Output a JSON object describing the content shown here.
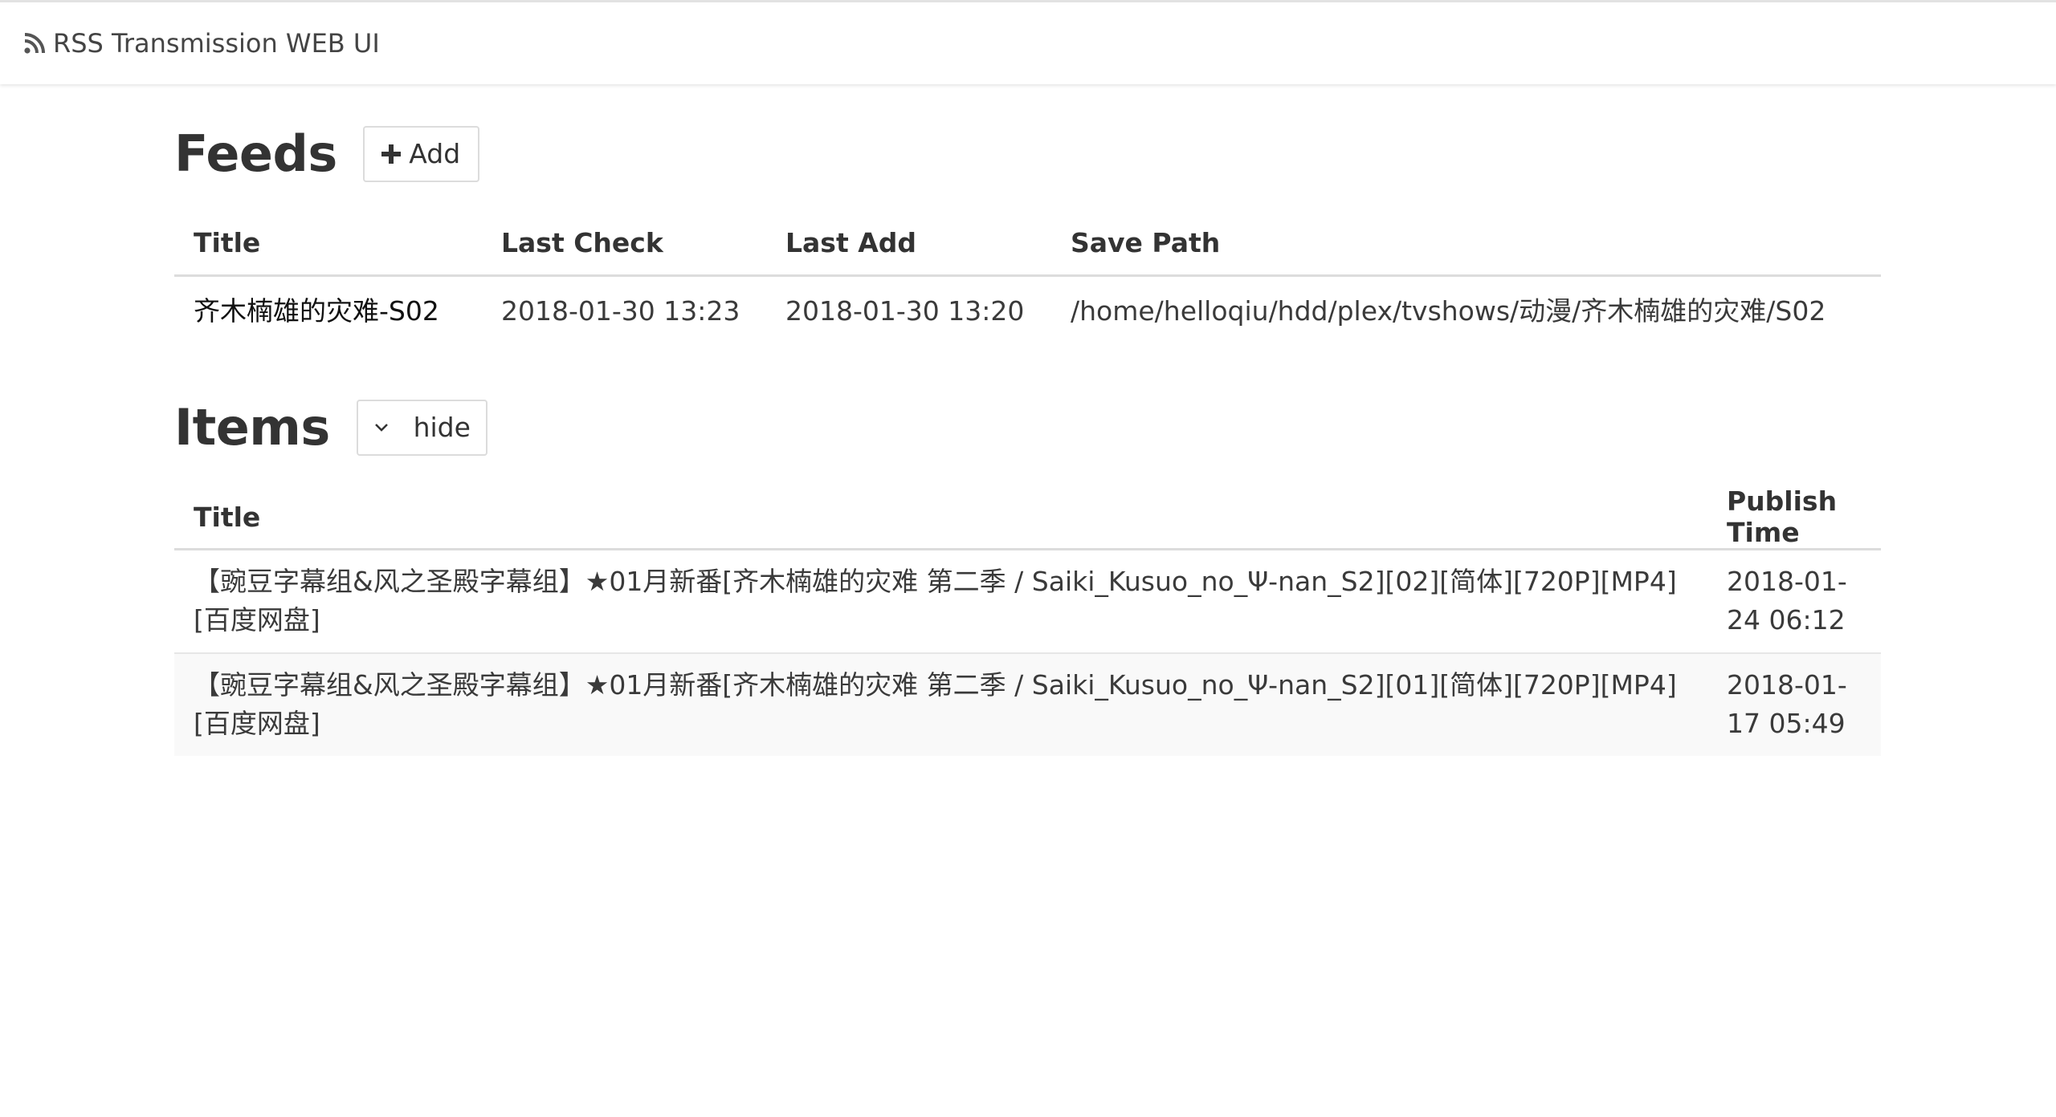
{
  "header": {
    "brand_icon": "rss-icon",
    "brand_text": "RSS Transmission WEB UI"
  },
  "feeds": {
    "heading": "Feeds",
    "add_button_icon": "plus-icon",
    "add_button_label": "Add",
    "columns": [
      "Title",
      "Last Check",
      "Last Add",
      "Save Path"
    ],
    "rows": [
      {
        "title": "齐木楠雄的灾难-S02",
        "last_check": "2018-01-30 13:23",
        "last_add": "2018-01-30 13:20",
        "save_path": "/home/helloqiu/hdd/plex/tvshows/动漫/齐木楠雄的灾难/S02"
      }
    ]
  },
  "items": {
    "heading": "Items",
    "hide_button_icon": "chevron-down-icon",
    "hide_button_label": "hide",
    "columns": [
      "Title",
      "Publish Time"
    ],
    "rows": [
      {
        "title": "【豌豆字幕组&风之圣殿字幕组】★01月新番[齐木楠雄的灾难 第二季 / Saiki_Kusuo_no_Ψ-nan_S2][02][简体][720P][MP4][百度网盘]",
        "publish_time": "2018-01-24 06:12"
      },
      {
        "title": "【豌豆字幕组&风之圣殿字幕组】★01月新番[齐木楠雄的灾难 第二季 / Saiki_Kusuo_no_Ψ-nan_S2][01][简体][720P][MP4][百度网盘]",
        "publish_time": "2018-01-17 05:49"
      }
    ]
  }
}
